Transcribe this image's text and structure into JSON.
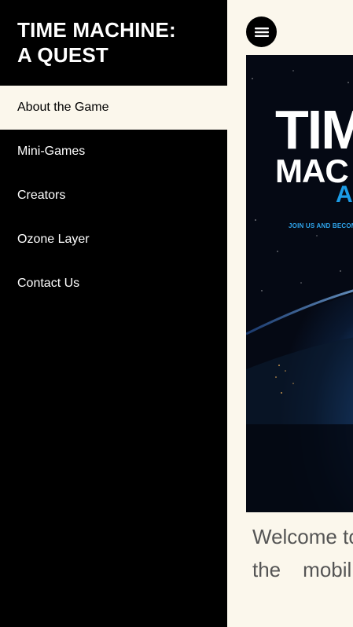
{
  "site": {
    "title_line1": "TIME MACHINE:",
    "title_line2": "A QUEST"
  },
  "nav": {
    "items": [
      {
        "label": "About the Game",
        "active": true
      },
      {
        "label": "Mini-Games",
        "active": false
      },
      {
        "label": "Creators",
        "active": false
      },
      {
        "label": "Ozone Layer",
        "active": false
      },
      {
        "label": "Contact Us",
        "active": false
      }
    ]
  },
  "menu_button": {
    "icon": "hamburger-menu-icon"
  },
  "hero": {
    "line1": "TIM",
    "line2": "MAC",
    "line3": "A",
    "tagline": "JOIN US AND BECOM"
  },
  "intro": {
    "line1": "Welcome to",
    "line2_word1": "the",
    "line2_word2": "mobil"
  },
  "colors": {
    "sidebar_bg": "#000000",
    "page_bg": "#fbf7ec",
    "accent_blue": "#1c9ce6"
  }
}
